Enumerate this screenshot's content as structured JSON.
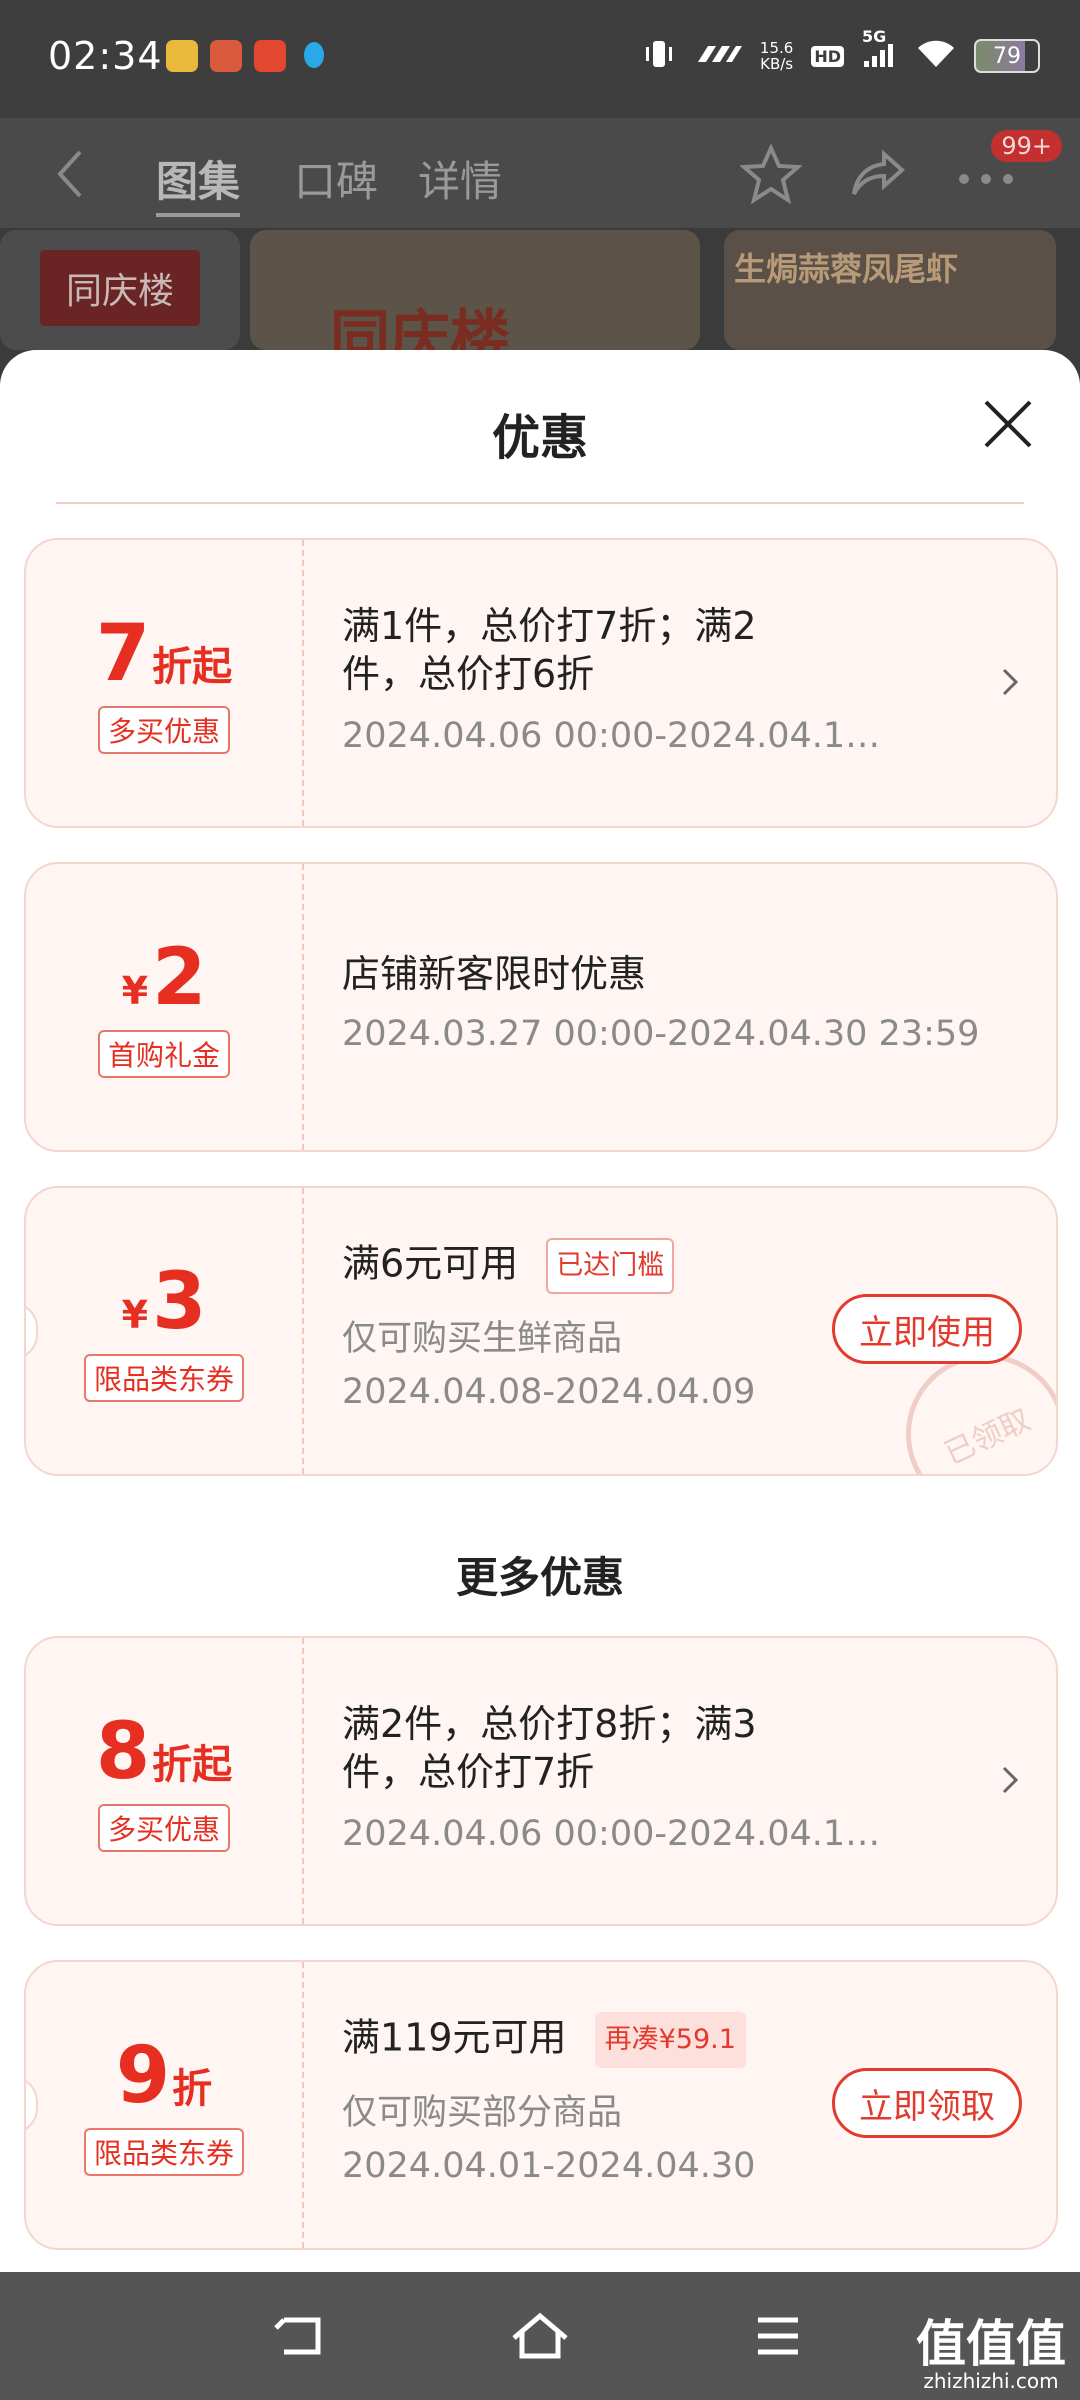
{
  "status_bar": {
    "time": "02:34",
    "net_speed": "15.6",
    "net_unit": "KB/s",
    "hd": "HD",
    "network": "5G",
    "battery": "79"
  },
  "header": {
    "tabs": [
      {
        "label": "图集"
      },
      {
        "label": "口碑"
      },
      {
        "label": "详情"
      }
    ],
    "badge": "99+",
    "banner_left": "同庆楼",
    "banner_mid": "同庆楼",
    "banner_right": "生焗蒜蓉凤尾虾"
  },
  "sheet": {
    "title": "优惠",
    "coupons": [
      {
        "big": "7",
        "small": "折起",
        "tag": "多买优惠",
        "desc": "满1件，总价打7折；满2件，总价打6折",
        "date": "2024.04.06 00:00-2024.04.1…"
      },
      {
        "currency": "¥",
        "big": "2",
        "tag": "首购礼金",
        "desc": "店铺新客限时优惠",
        "date": "2024.03.27 00:00-2024.04.30 23:59"
      },
      {
        "currency": "¥",
        "big": "3",
        "tag": "限品类东券",
        "desc": "满6元可用",
        "badge": "已达门槛",
        "sub": "仅可购买生鲜商品",
        "date": "2024.04.08-2024.04.09",
        "button": "立即使用",
        "stamp": "已领取"
      }
    ],
    "more_title": "更多优惠",
    "more_coupons": [
      {
        "big": "8",
        "small": "折起",
        "tag": "多买优惠",
        "desc": "满2件，总价打8折；满3件，总价打7折",
        "date": "2024.04.06 00:00-2024.04.1…"
      },
      {
        "big": "9",
        "small": "折",
        "tag": "限品类东券",
        "desc": "满119元可用",
        "badge": "再凑¥59.1",
        "sub": "仅可购买部分商品",
        "date": "2024.04.01-2024.04.30",
        "button": "立即领取"
      }
    ]
  },
  "watermark": {
    "text": "值值值",
    "url": "zhizhizhi.com"
  }
}
